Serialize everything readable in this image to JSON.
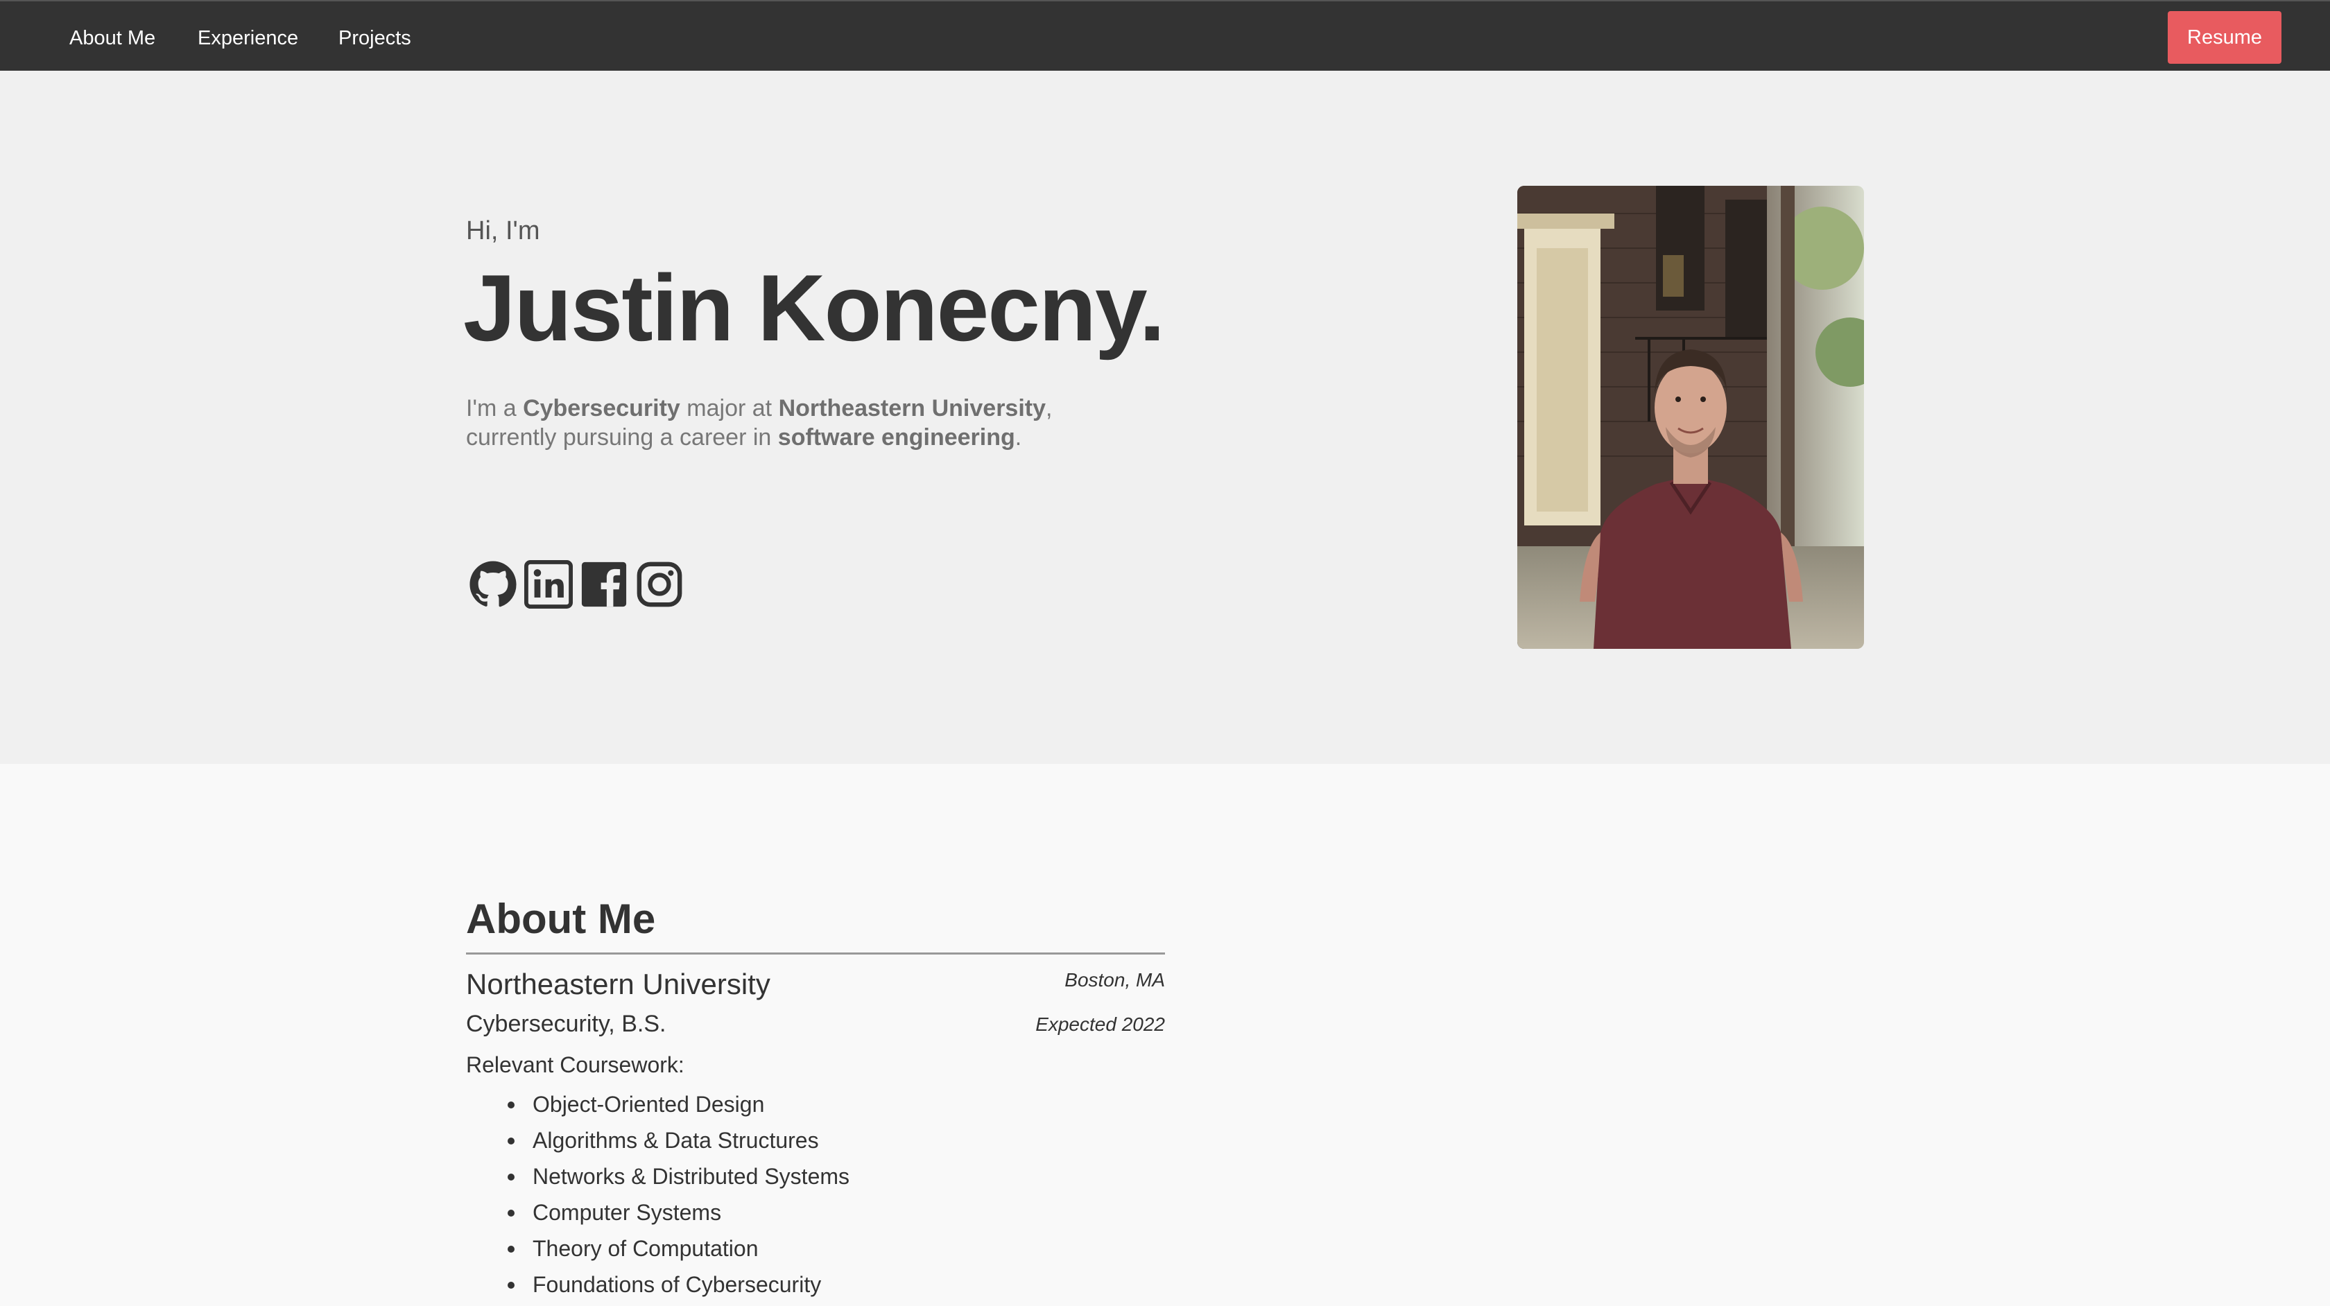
{
  "nav": {
    "items": [
      {
        "label": "About Me"
      },
      {
        "label": "Experience"
      },
      {
        "label": "Projects"
      }
    ],
    "resume_label": "Resume",
    "accent": "#e85b5f",
    "background": "#333333"
  },
  "hero": {
    "greeting": "Hi, I'm",
    "name": "Justin Konecny.",
    "intro": {
      "p1": "I'm a ",
      "major": "Cybersecurity",
      "p2": " major at ",
      "school": "Northeastern University",
      "p3": ",",
      "p4": "currently pursuing a career in ",
      "career": "software engineering",
      "p5": "."
    },
    "social_icons": [
      "github-icon",
      "linkedin-icon",
      "facebook-icon",
      "instagram-icon"
    ],
    "portrait": "portrait-photo"
  },
  "about": {
    "title": "About Me",
    "school": "Northeastern University",
    "location": "Boston, MA",
    "degree": "Cybersecurity, B.S.",
    "expected": "Expected 2022",
    "coursework_label": "Relevant Coursework:",
    "coursework": [
      "Object-Oriented Design",
      "Algorithms & Data Structures",
      "Networks & Distributed Systems",
      "Computer Systems",
      "Theory of Computation",
      "Foundations of Cybersecurity"
    ]
  }
}
